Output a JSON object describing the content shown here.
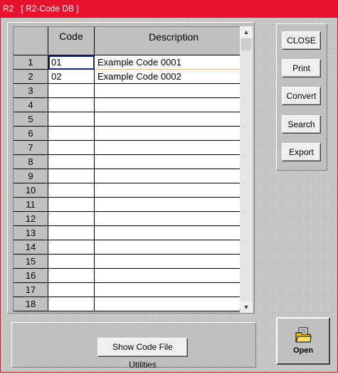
{
  "window": {
    "title": "R2   [ R2-Code DB ]"
  },
  "grid": {
    "columns": {
      "code": "Code",
      "description": "Description"
    },
    "rows": [
      {
        "num": "1",
        "code": "01",
        "description": "Example Code 0001"
      },
      {
        "num": "2",
        "code": "02",
        "description": "Example Code 0002"
      },
      {
        "num": "3",
        "code": "",
        "description": ""
      },
      {
        "num": "4",
        "code": "",
        "description": ""
      },
      {
        "num": "5",
        "code": "",
        "description": ""
      },
      {
        "num": "6",
        "code": "",
        "description": ""
      },
      {
        "num": "7",
        "code": "",
        "description": ""
      },
      {
        "num": "8",
        "code": "",
        "description": ""
      },
      {
        "num": "9",
        "code": "",
        "description": ""
      },
      {
        "num": "10",
        "code": "",
        "description": ""
      },
      {
        "num": "11",
        "code": "",
        "description": ""
      },
      {
        "num": "12",
        "code": "",
        "description": ""
      },
      {
        "num": "13",
        "code": "",
        "description": ""
      },
      {
        "num": "14",
        "code": "",
        "description": ""
      },
      {
        "num": "15",
        "code": "",
        "description": ""
      },
      {
        "num": "16",
        "code": "",
        "description": ""
      },
      {
        "num": "17",
        "code": "",
        "description": ""
      },
      {
        "num": "18",
        "code": "",
        "description": ""
      }
    ],
    "scroll_up_icon": "chevron-up-icon",
    "scroll_down_icon": "chevron-down-icon"
  },
  "buttons": {
    "close": "CLOSE",
    "print": "Print",
    "convert": "Convert",
    "search": "Search",
    "export": "Export",
    "utilities": "Show Code File Utilities",
    "open": "Open",
    "open_icon": "open-folder-icon"
  },
  "colors": {
    "title_bar": "#e8112d",
    "title_text": "#ffffff",
    "window_bg": "#c0c0c0",
    "current_row_border": "#e8b87a",
    "focus_outline": "#1a2a6c"
  }
}
